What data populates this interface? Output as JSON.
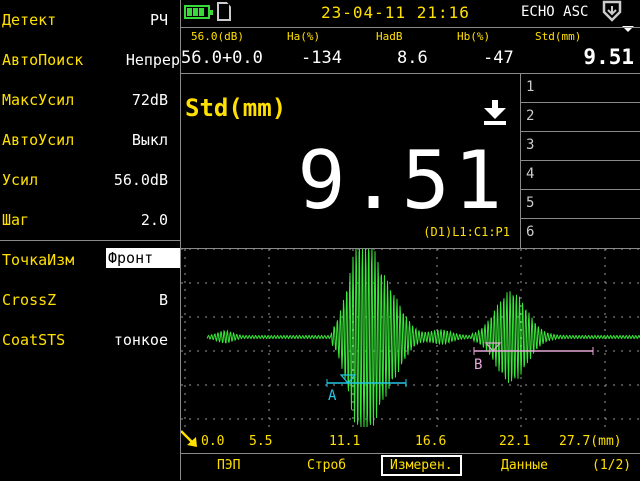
{
  "left_panel": {
    "params": [
      {
        "label": "Детект",
        "value": "РЧ"
      },
      {
        "label": "АвтоПоиск",
        "value": "Непрер"
      },
      {
        "label": "МаксУсил",
        "value": "72dB"
      },
      {
        "label": "АвтоУсил",
        "value": "Выкл"
      },
      {
        "label": "Усил",
        "value": "56.0dB"
      },
      {
        "label": "Шаг",
        "value": "2.0"
      },
      {
        "label": "ТочкаИзм",
        "value": "Фронт"
      },
      {
        "label": "CrossZ",
        "value": "В"
      },
      {
        "label": "CoatSTS",
        "value": "тонкое"
      }
    ]
  },
  "status": {
    "datetime": "23-04-11 21:16",
    "mode": "ECHO ASC",
    "battery_level": 0.75,
    "icons": [
      "battery-icon",
      "sd-card-icon",
      "logo-icon",
      "down-arrow-icon"
    ]
  },
  "measurements": {
    "headers": [
      "56.0(dB)",
      "Ha(%)",
      "HadB",
      "Hb(%)",
      "Std(mm)"
    ],
    "values": [
      "56.0+0.0",
      "-134",
      "8.6",
      "-47",
      "9.51"
    ]
  },
  "reading": {
    "title": "Std(mm)",
    "value": "9.51",
    "sub": "(D1)L1:C1:P1"
  },
  "slots": [
    "1",
    "2",
    "3",
    "4",
    "5",
    "6"
  ],
  "scope": {
    "axis_ticks": [
      "0.0",
      "5.5",
      "11.1",
      "16.6",
      "22.1",
      "27.7(mm)"
    ],
    "gate_a_label": "A",
    "gate_b_label": "B",
    "colors": {
      "signal": "#39e639",
      "gate_a": "#22c8e6",
      "gate_b": "#e6a8d8",
      "axis": "#ffe000"
    }
  },
  "tabs": [
    "ПЭП",
    "Строб",
    "Измерен.",
    "Данные",
    "(1/2)"
  ],
  "active_tab": 2
}
